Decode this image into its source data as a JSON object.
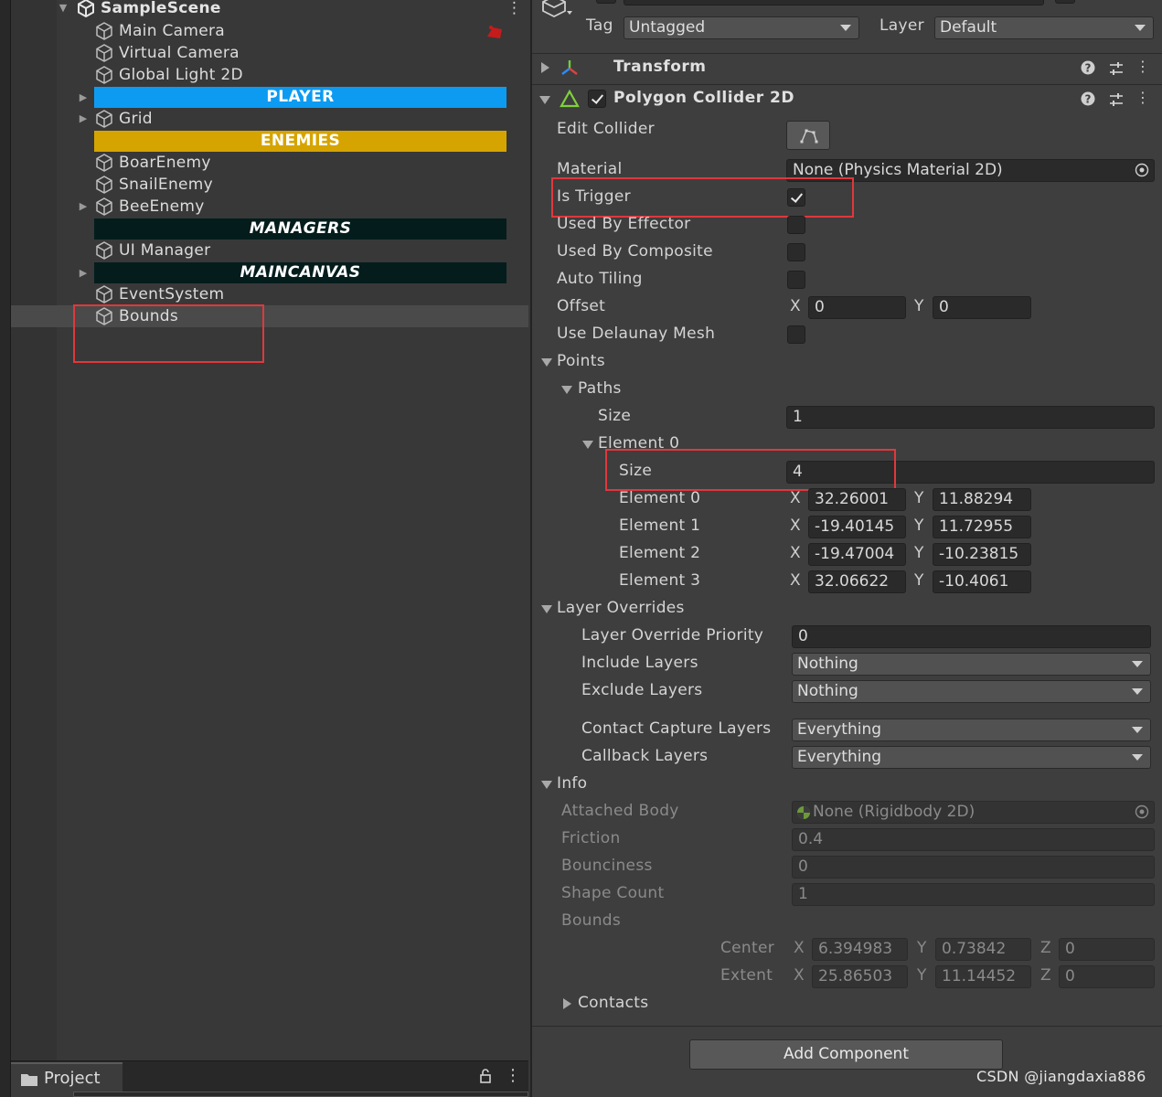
{
  "hierarchy": {
    "scene_name": "SampleScene",
    "items": [
      {
        "label": "Main Camera"
      },
      {
        "label": "Virtual Camera"
      },
      {
        "label": "Global Light 2D"
      },
      {
        "label": "PLAYER"
      },
      {
        "label": "Grid"
      },
      {
        "label": "ENEMIES"
      },
      {
        "label": "BoarEnemy"
      },
      {
        "label": "SnailEnemy"
      },
      {
        "label": "BeeEnemy"
      },
      {
        "label": "MANAGERS"
      },
      {
        "label": "UI Manager"
      },
      {
        "label": "MAINCANVAS"
      },
      {
        "label": "EventSystem"
      },
      {
        "label": "Bounds"
      }
    ],
    "header_colors": {
      "player": "#0d9bf2",
      "enemies": "#d6a400",
      "dark": "#041c1c"
    }
  },
  "project_tab": {
    "label": "Project"
  },
  "inspector": {
    "tag_label": "Tag",
    "tag_value": "Untagged",
    "layer_label": "Layer",
    "layer_value": "Default",
    "transform_title": "Transform",
    "collider_title": "Polygon Collider 2D",
    "edit_collider_label": "Edit Collider",
    "material_label": "Material",
    "material_value": "None (Physics Material 2D)",
    "is_trigger_label": "Is Trigger",
    "is_trigger": true,
    "used_by_effector_label": "Used By Effector",
    "used_by_composite_label": "Used By Composite",
    "auto_tiling_label": "Auto Tiling",
    "offset_label": "Offset",
    "offset_x": "0",
    "offset_y": "0",
    "use_delaunay_label": "Use Delaunay Mesh",
    "points_label": "Points",
    "paths_label": "Paths",
    "paths_size_label": "Size",
    "paths_size_value": "1",
    "element0_label": "Element 0",
    "element0_size_label": "Size",
    "element0_size_value": "4",
    "points": [
      {
        "label": "Element 0",
        "x": "32.26001",
        "y": "11.88294"
      },
      {
        "label": "Element 1",
        "x": "-19.40145",
        "y": "11.72955"
      },
      {
        "label": "Element 2",
        "x": "-19.47004",
        "y": "-10.23815"
      },
      {
        "label": "Element 3",
        "x": "32.06622",
        "y": "-10.4061"
      }
    ],
    "layer_overrides_label": "Layer Overrides",
    "layer_override_priority_label": "Layer Override Priority",
    "layer_override_priority_value": "0",
    "include_layers_label": "Include Layers",
    "include_layers_value": "Nothing",
    "exclude_layers_label": "Exclude Layers",
    "exclude_layers_value": "Nothing",
    "contact_capture_label": "Contact Capture Layers",
    "contact_capture_value": "Everything",
    "callback_layers_label": "Callback Layers",
    "callback_layers_value": "Everything",
    "info_label": "Info",
    "attached_body_label": "Attached Body",
    "attached_body_value": "None (Rigidbody 2D)",
    "friction_label": "Friction",
    "friction_value": "0.4",
    "bounciness_label": "Bounciness",
    "bounciness_value": "0",
    "shape_count_label": "Shape Count",
    "shape_count_value": "1",
    "bounds_label": "Bounds",
    "center_label": "Center",
    "center_x": "6.394983",
    "center_y": "0.73842",
    "center_z": "0",
    "extent_label": "Extent",
    "extent_x": "25.86503",
    "extent_y": "11.14452",
    "extent_z": "0",
    "contacts_label": "Contacts",
    "add_component_label": "Add Component",
    "axis_x": "X",
    "axis_y": "Y",
    "axis_z": "Z"
  },
  "watermark": "CSDN @jiangdaxia886",
  "icons": [
    "unity-scene-icon",
    "gameobject-cube-icon",
    "fold-arrow-icon",
    "kebab-menu-icon",
    "help-icon",
    "preset-icon",
    "transform-icon",
    "polygon-collider-icon",
    "edit-collider-icon",
    "object-picker-icon",
    "lock-icon",
    "folder-icon"
  ],
  "annotation_color": "#e0383c"
}
